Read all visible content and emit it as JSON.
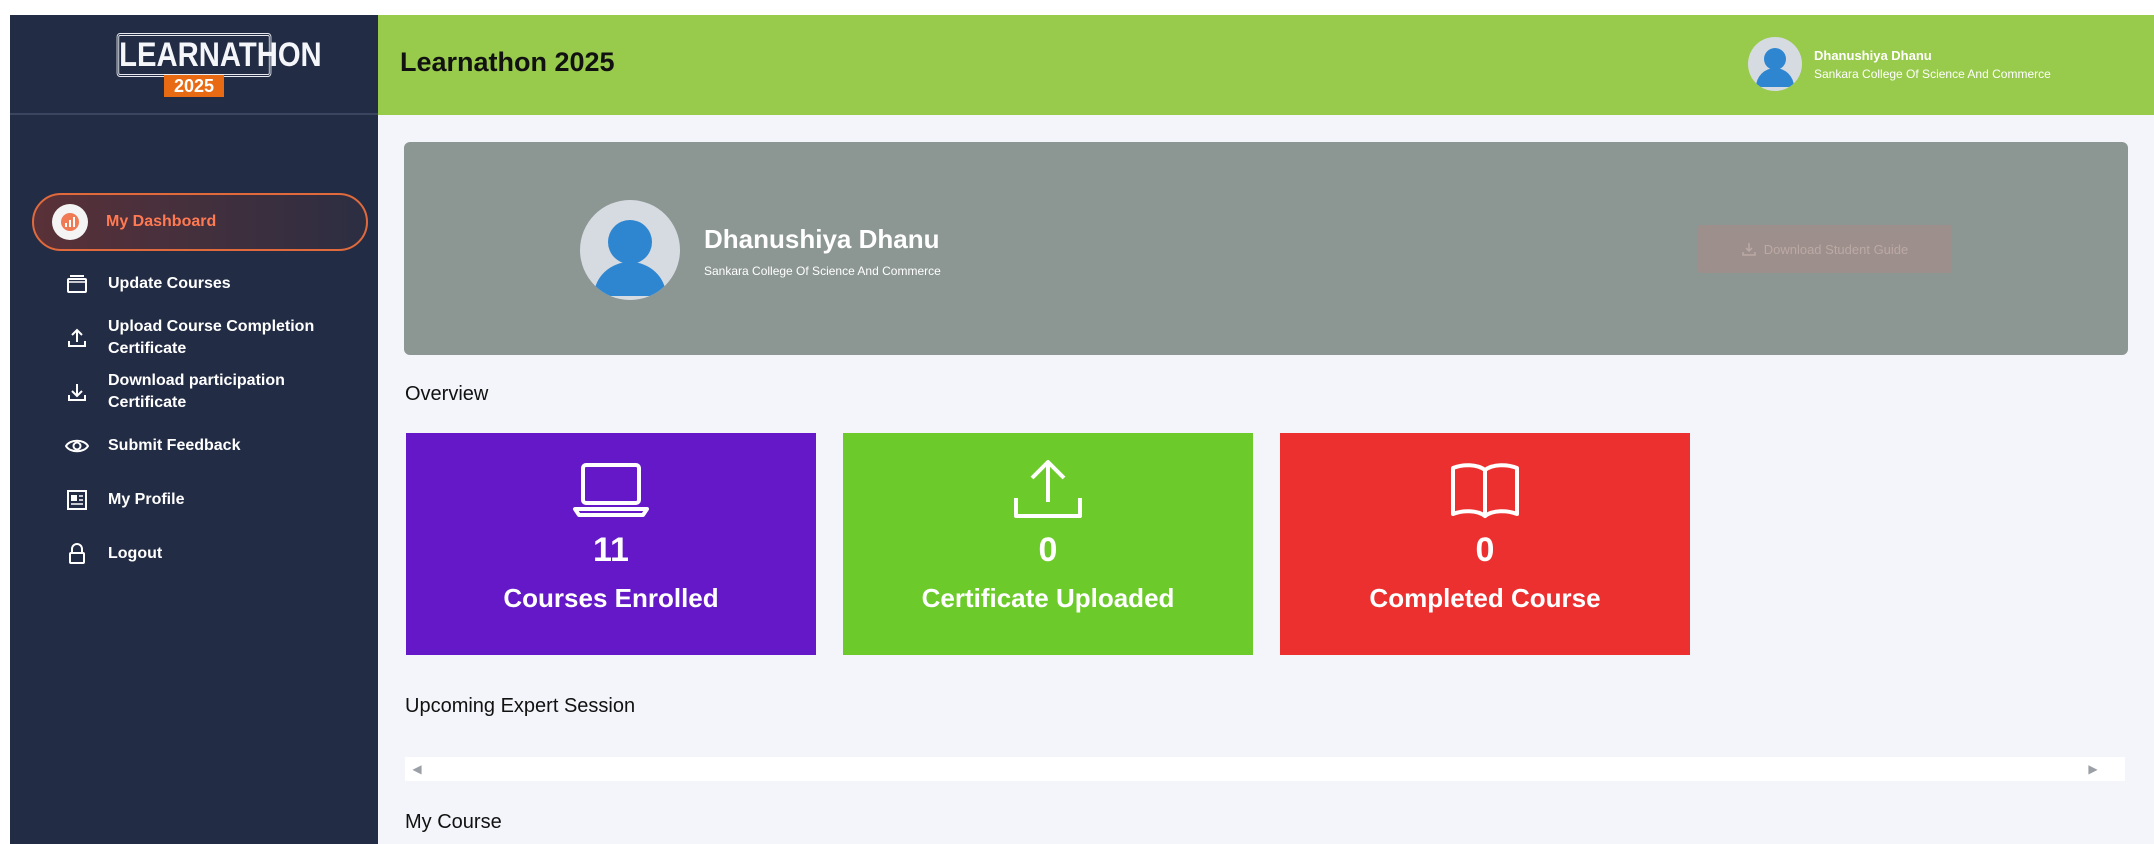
{
  "brand": {
    "logo_text": "LEARNATHON",
    "logo_year": "2025"
  },
  "header": {
    "title": "Learnathon 2025",
    "user_name": "Dhanushiya Dhanu",
    "user_college": "Sankara College Of Science And Commerce"
  },
  "sidebar": {
    "items": [
      {
        "label": "My Dashboard",
        "icon": "chart-icon",
        "active": true
      },
      {
        "label": "Update Courses",
        "icon": "window-icon"
      },
      {
        "label": "Upload Course Completion\nCertificate",
        "icon": "upload-icon"
      },
      {
        "label": "Download participation\nCertificate",
        "icon": "download-icon"
      },
      {
        "label": "Submit Feedback",
        "icon": "eye-icon"
      },
      {
        "label": "My Profile",
        "icon": "profile-card-icon"
      },
      {
        "label": "Logout",
        "icon": "lock-icon"
      }
    ]
  },
  "profile": {
    "name": "Dhanushiya Dhanu",
    "college": "Sankara College Of Science And Commerce",
    "guide_button": "Download Student Guide"
  },
  "overview": {
    "title": "Overview",
    "cards": [
      {
        "value": "11",
        "label": "Courses Enrolled",
        "icon": "laptop-icon",
        "color": "#6418c8"
      },
      {
        "value": "0",
        "label": "Certificate Uploaded",
        "icon": "upload-icon",
        "color": "#6ccb2b"
      },
      {
        "value": "0",
        "label": "Completed Course",
        "icon": "book-icon",
        "color": "#ec3030"
      }
    ]
  },
  "sections": {
    "upcoming": "Upcoming Expert Session",
    "my_course": "My Course"
  },
  "colors": {
    "sidebar_bg": "#222c44",
    "header_bg": "#98cb4b",
    "active_accent": "#ff7a52",
    "hero_bg": "#8c9692"
  }
}
